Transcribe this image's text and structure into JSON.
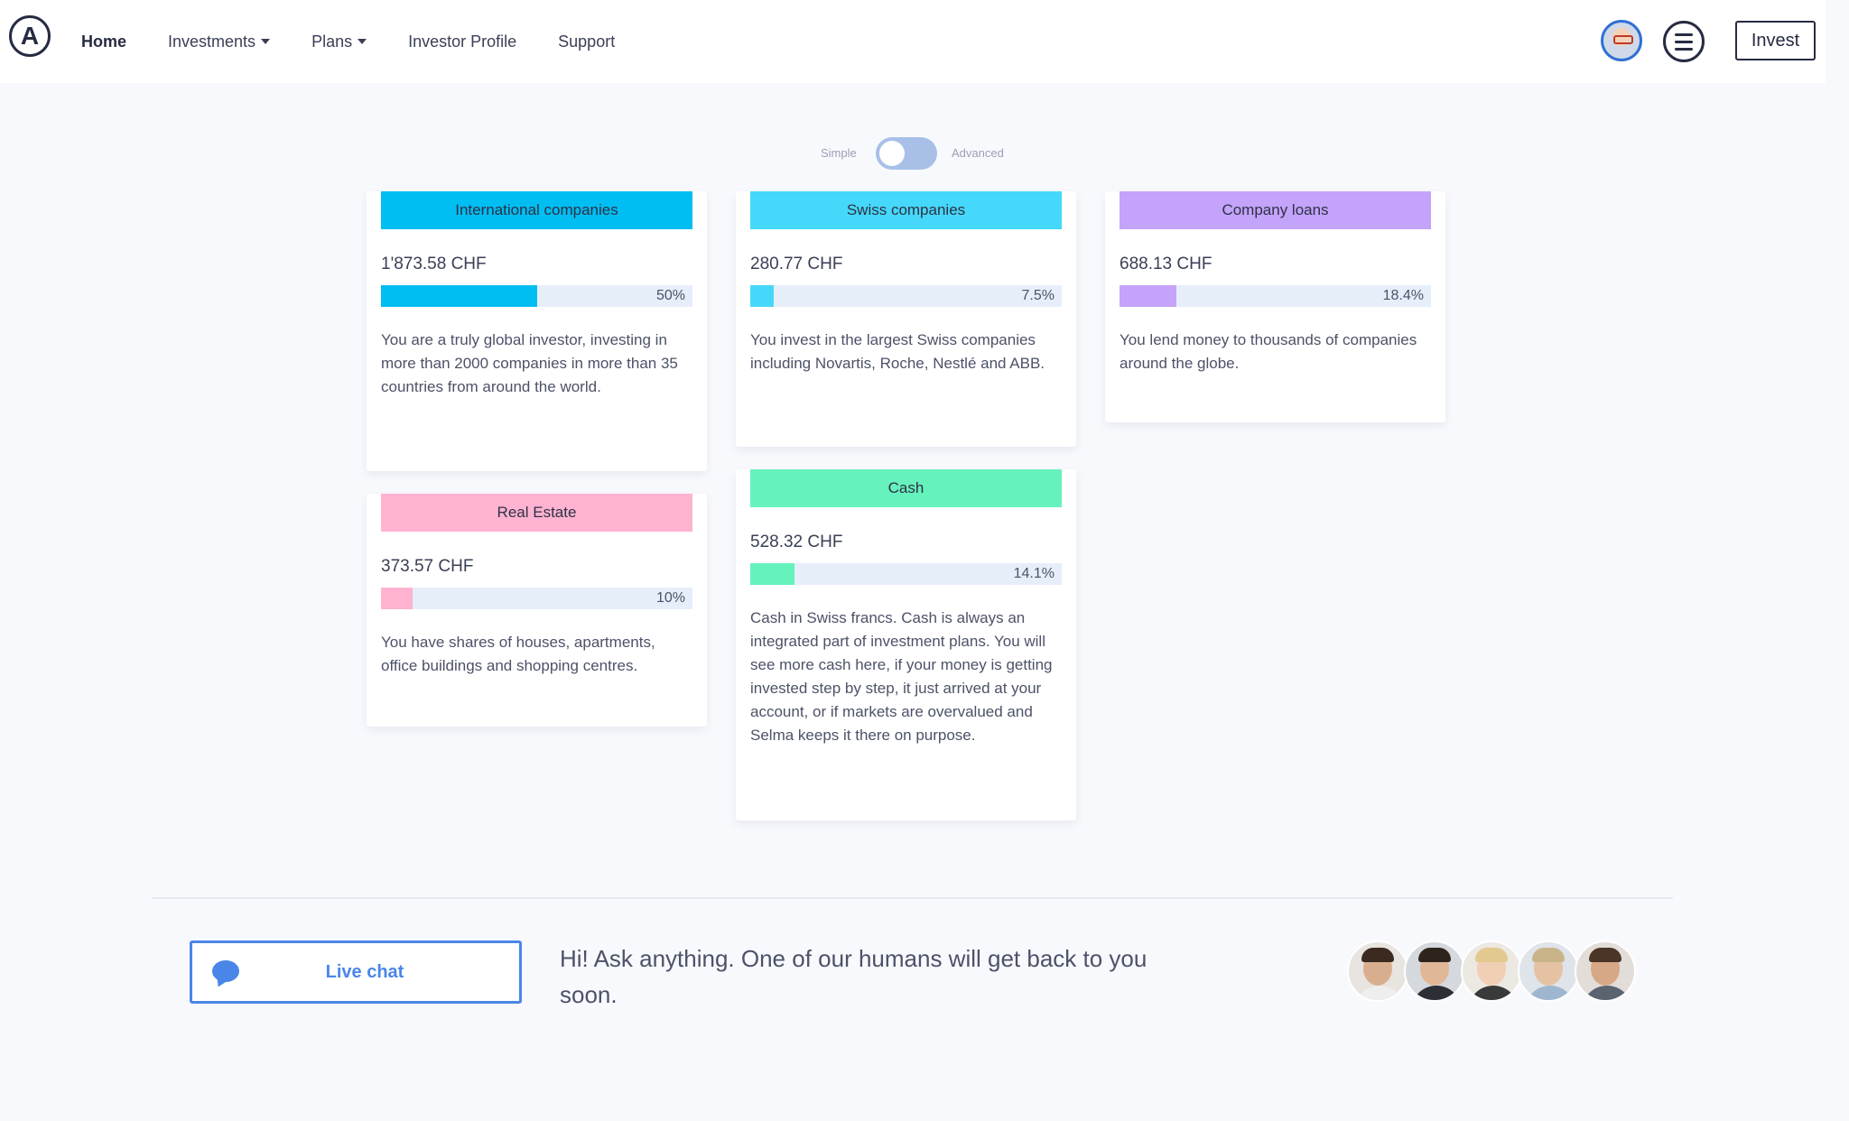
{
  "nav": {
    "home": "Home",
    "investments": "Investments",
    "plans": "Plans",
    "investor_profile": "Investor Profile",
    "support": "Support",
    "invest_button": "Invest"
  },
  "toggle": {
    "simple": "Simple",
    "advanced": "Advanced",
    "state": "simple"
  },
  "cards": [
    {
      "title": "International companies",
      "amount": "1'873.58  CHF",
      "percent_label": "50%",
      "percent": 50,
      "color": "#00bdf2",
      "description": "You are a truly global investor, investing in more than 2000 companies in more than 35 countries from around the world."
    },
    {
      "title": "Swiss companies",
      "amount": "280.77  CHF",
      "percent_label": "7.5%",
      "percent": 7.5,
      "color": "#45d8fa",
      "description": "You invest in the largest Swiss companies including Novartis, Roche, Nestlé and ABB."
    },
    {
      "title": "Company loans",
      "amount": "688.13  CHF",
      "percent_label": "18.4%",
      "percent": 18.4,
      "color": "#c4a3fa",
      "description": "You lend money to thousands of companies around the globe."
    },
    {
      "title": "Real Estate",
      "amount": "373.57  CHF",
      "percent_label": "10%",
      "percent": 10,
      "color": "#ffb3d1",
      "description": "You have shares of houses, apartments, office buildings and shopping centres."
    },
    {
      "title": "Cash",
      "amount": "528.32  CHF",
      "percent_label": "14.1%",
      "percent": 14.1,
      "color": "#66f2bd",
      "description": "Cash in Swiss francs. Cash is always an integrated part of investment plans. You will see more cash here, if your money is getting invested step by step, it just arrived at your account, or if markets are overvalued and Selma keeps it there on purpose."
    }
  ],
  "footer": {
    "live_chat": "Live chat",
    "message": "Hi! Ask anything. One of our humans will get back to you soon."
  },
  "icons": {
    "logo": "logo-a-icon",
    "avatar": "user-avatar",
    "menu": "hamburger-menu-icon",
    "chat": "chat-bubble-icon"
  }
}
